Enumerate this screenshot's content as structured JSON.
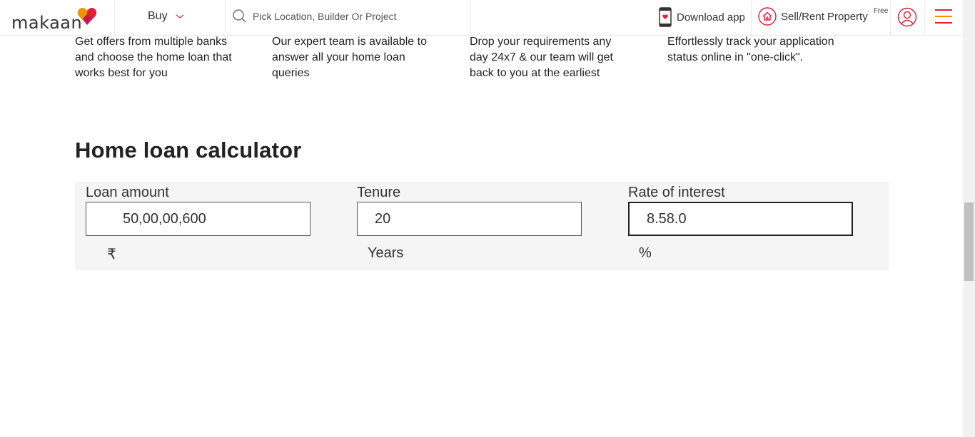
{
  "header": {
    "logo_text": "makaan",
    "buy_label": "Buy",
    "search_placeholder": "Pick Location, Builder Or Project",
    "download_label": "Download app",
    "sell_label": "Sell/Rent Property",
    "free_label": "Free",
    "brand_colors": {
      "red": "#e71c37",
      "orange": "#f39200",
      "pink": "#c2185b"
    }
  },
  "benefits": [
    {
      "text": "Get offers from multiple banks and choose the home loan that works best for you"
    },
    {
      "text": "Our expert team is available to answer all your home loan queries"
    },
    {
      "text": "Drop your requirements any day 24x7 & our team will get back to you at the earliest"
    },
    {
      "text": "Effortlessly track your application status online in \"one-click\"."
    }
  ],
  "calculator": {
    "title": "Home loan calculator",
    "loan_amount": {
      "label": "Loan amount",
      "value": "50,00,00,600",
      "unit": "₹"
    },
    "tenure": {
      "label": "Tenure",
      "value": "20",
      "unit": "Years"
    },
    "rate": {
      "label": "Rate of interest",
      "value": "8.58.0",
      "unit": "%"
    }
  },
  "icons": {
    "search": "search-icon",
    "chevron": "chevron-down-icon",
    "phone": "phone-icon",
    "home_sell": "home-sell-icon",
    "user": "user-icon",
    "menu": "hamburger-menu-icon"
  }
}
